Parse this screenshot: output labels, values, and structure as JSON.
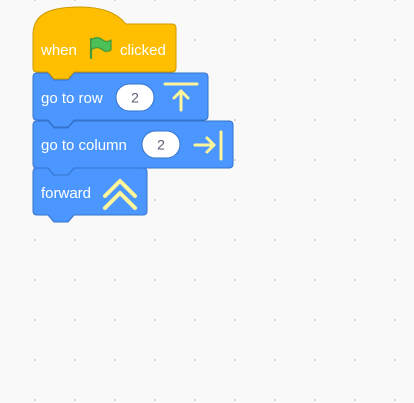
{
  "workspace": {
    "script": {
      "hat_block": {
        "label_before": "when",
        "icon": "green-flag-icon",
        "label_after": "clicked",
        "color": "#ffbf00",
        "border_color": "#cc9900",
        "flag_color": "#4cbf56"
      },
      "go_to_row_block": {
        "label": "go to row",
        "value": "2",
        "icon": "arrow-up-to-top-edge-icon",
        "color": "#4c97ff",
        "border_color": "#3373cc"
      },
      "go_to_column_block": {
        "label": "go to column",
        "value": "2",
        "icon": "arrow-right-to-edge-icon",
        "color": "#4c97ff",
        "border_color": "#3373cc"
      },
      "forward_block": {
        "label": "forward",
        "icon": "double-chevron-up-icon",
        "color": "#4c97ff",
        "border_color": "#3373cc"
      },
      "icon_color": "#fff59a"
    }
  }
}
